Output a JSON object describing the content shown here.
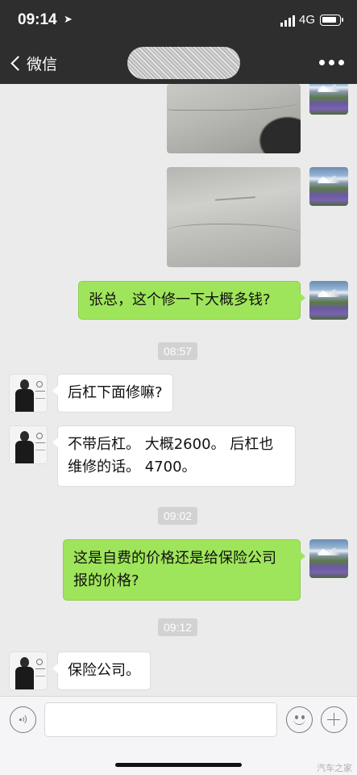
{
  "status_bar": {
    "time": "09:14",
    "network": "4G",
    "location_icon": "location-arrow-icon",
    "signal_icon": "signal-bars-icon",
    "battery_icon": "battery-icon"
  },
  "nav": {
    "back_label": "微信",
    "back_icon": "chevron-left-icon",
    "more_icon": "more-dots-icon"
  },
  "messages": [
    {
      "type": "image",
      "direction": "out",
      "content": "car-scratch-photo-1"
    },
    {
      "type": "image",
      "direction": "out",
      "content": "car-scratch-photo-2"
    },
    {
      "type": "text",
      "direction": "out",
      "text": "张总，这个修一下大概多钱?"
    },
    {
      "type": "time",
      "text": "08:57"
    },
    {
      "type": "text",
      "direction": "in",
      "text": "后杠下面修嘛?"
    },
    {
      "type": "text",
      "direction": "in",
      "line1": "不带后杠。 大概2600。 后杠也",
      "line2": "维修的话。 4700。"
    },
    {
      "type": "time",
      "text": "09:02"
    },
    {
      "type": "text",
      "direction": "out",
      "line1": "这是自费的价格还是给保险公司",
      "line2": "报的价格?"
    },
    {
      "type": "time",
      "text": "09:12"
    },
    {
      "type": "text",
      "direction": "in",
      "text": "保险公司。"
    }
  ],
  "input_bar": {
    "voice_icon": "voice-icon",
    "emoji_icon": "emoji-icon",
    "plus_icon": "plus-icon"
  },
  "watermark": "汽车之家",
  "colors": {
    "bar_bg": "#2e2e2e",
    "chat_bg": "#ebebeb",
    "out_bubble": "#9fe55b",
    "in_bubble": "#ffffff"
  }
}
